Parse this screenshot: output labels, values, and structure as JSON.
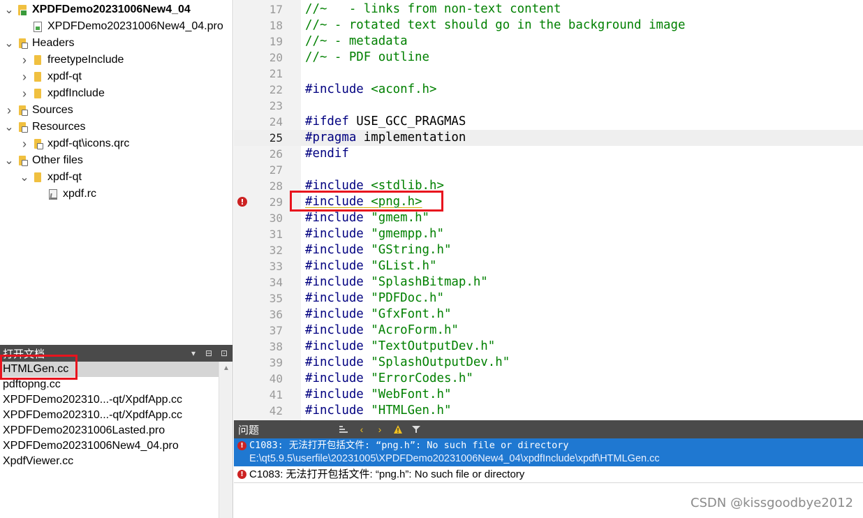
{
  "project_tree": {
    "rows": [
      {
        "label": "XPDFDemo20231006New4_04",
        "icon": "project-icon",
        "arrow": "v",
        "bold": true
      },
      {
        "label": "XPDFDemo20231006New4_04.pro",
        "icon": "pro-file-icon",
        "arrow": ""
      },
      {
        "label": "Headers",
        "icon": "headers-folder-icon",
        "arrow": "v"
      },
      {
        "label": "freetypeInclude",
        "icon": "folder-icon",
        "arrow": ">"
      },
      {
        "label": "xpdf-qt",
        "icon": "folder-icon",
        "arrow": ">"
      },
      {
        "label": "xpdfInclude",
        "icon": "folder-icon",
        "arrow": ">"
      },
      {
        "label": "Sources",
        "icon": "sources-folder-icon",
        "arrow": ">"
      },
      {
        "label": "Resources",
        "icon": "resources-folder-icon",
        "arrow": "v"
      },
      {
        "label": "xpdf-qt\\icons.qrc",
        "icon": "qrc-file-icon",
        "arrow": ">"
      },
      {
        "label": "Other files",
        "icon": "other-files-folder-icon",
        "arrow": "v"
      },
      {
        "label": "xpdf-qt",
        "icon": "folder-icon",
        "arrow": "v"
      },
      {
        "label": "xpdf.rc",
        "icon": "rc-file-icon",
        "arrow": ""
      }
    ]
  },
  "open_documents": {
    "title": "打开文档",
    "items": [
      "HTMLGen.cc",
      "pdftopng.cc",
      "XPDFDemo202310...-qt/XpdfApp.cc",
      "XPDFDemo202310...-qt/XpdfApp.cc",
      "XPDFDemo20231006Lasted.pro",
      "XPDFDemo20231006New4_04.pro",
      "XpdfViewer.cc"
    ],
    "selected_index": 0
  },
  "editor": {
    "current_line": 25,
    "error_line": 29,
    "lines": [
      {
        "n": "17",
        "tokens": [
          {
            "t": "//~   - links from non-text content",
            "c": "comment"
          }
        ]
      },
      {
        "n": "18",
        "tokens": [
          {
            "t": "//~ - rotated text should go in the background image",
            "c": "comment"
          }
        ]
      },
      {
        "n": "19",
        "tokens": [
          {
            "t": "//~ - metadata",
            "c": "comment"
          }
        ]
      },
      {
        "n": "20",
        "tokens": [
          {
            "t": "//~ - PDF outline",
            "c": "comment"
          }
        ]
      },
      {
        "n": "21",
        "tokens": []
      },
      {
        "n": "22",
        "tokens": [
          {
            "t": "#include",
            "c": "directive"
          },
          {
            "t": " ",
            "c": "plain"
          },
          {
            "t": "<aconf.h>",
            "c": "sys"
          }
        ]
      },
      {
        "n": "23",
        "tokens": []
      },
      {
        "n": "24",
        "tokens": [
          {
            "t": "#ifdef",
            "c": "directive"
          },
          {
            "t": " USE_GCC_PRAGMAS",
            "c": "plain"
          }
        ]
      },
      {
        "n": "25",
        "tokens": [
          {
            "t": "#pragma",
            "c": "directive"
          },
          {
            "t": " implementation",
            "c": "plain"
          }
        ]
      },
      {
        "n": "26",
        "tokens": [
          {
            "t": "#endif",
            "c": "directive"
          }
        ]
      },
      {
        "n": "27",
        "tokens": []
      },
      {
        "n": "28",
        "tokens": [
          {
            "t": "#include",
            "c": "directive"
          },
          {
            "t": " ",
            "c": "plain"
          },
          {
            "t": "<stdlib.h>",
            "c": "sys"
          }
        ]
      },
      {
        "n": "29",
        "tokens": [
          {
            "t": "#include",
            "c": "directive"
          },
          {
            "t": " ",
            "c": "plain"
          },
          {
            "t": "<png.h>",
            "c": "sys"
          }
        ]
      },
      {
        "n": "30",
        "tokens": [
          {
            "t": "#include",
            "c": "directive"
          },
          {
            "t": " ",
            "c": "plain"
          },
          {
            "t": "\"gmem.h\"",
            "c": "str"
          }
        ]
      },
      {
        "n": "31",
        "tokens": [
          {
            "t": "#include",
            "c": "directive"
          },
          {
            "t": " ",
            "c": "plain"
          },
          {
            "t": "\"gmempp.h\"",
            "c": "str"
          }
        ]
      },
      {
        "n": "32",
        "tokens": [
          {
            "t": "#include",
            "c": "directive"
          },
          {
            "t": " ",
            "c": "plain"
          },
          {
            "t": "\"GString.h\"",
            "c": "str"
          }
        ]
      },
      {
        "n": "33",
        "tokens": [
          {
            "t": "#include",
            "c": "directive"
          },
          {
            "t": " ",
            "c": "plain"
          },
          {
            "t": "\"GList.h\"",
            "c": "str"
          }
        ]
      },
      {
        "n": "34",
        "tokens": [
          {
            "t": "#include",
            "c": "directive"
          },
          {
            "t": " ",
            "c": "plain"
          },
          {
            "t": "\"SplashBitmap.h\"",
            "c": "str"
          }
        ]
      },
      {
        "n": "35",
        "tokens": [
          {
            "t": "#include",
            "c": "directive"
          },
          {
            "t": " ",
            "c": "plain"
          },
          {
            "t": "\"PDFDoc.h\"",
            "c": "str"
          }
        ]
      },
      {
        "n": "36",
        "tokens": [
          {
            "t": "#include",
            "c": "directive"
          },
          {
            "t": " ",
            "c": "plain"
          },
          {
            "t": "\"GfxFont.h\"",
            "c": "str"
          }
        ]
      },
      {
        "n": "37",
        "tokens": [
          {
            "t": "#include",
            "c": "directive"
          },
          {
            "t": " ",
            "c": "plain"
          },
          {
            "t": "\"AcroForm.h\"",
            "c": "str"
          }
        ]
      },
      {
        "n": "38",
        "tokens": [
          {
            "t": "#include",
            "c": "directive"
          },
          {
            "t": " ",
            "c": "plain"
          },
          {
            "t": "\"TextOutputDev.h\"",
            "c": "str"
          }
        ]
      },
      {
        "n": "39",
        "tokens": [
          {
            "t": "#include",
            "c": "directive"
          },
          {
            "t": " ",
            "c": "plain"
          },
          {
            "t": "\"SplashOutputDev.h\"",
            "c": "str"
          }
        ]
      },
      {
        "n": "40",
        "tokens": [
          {
            "t": "#include",
            "c": "directive"
          },
          {
            "t": " ",
            "c": "plain"
          },
          {
            "t": "\"ErrorCodes.h\"",
            "c": "str"
          }
        ]
      },
      {
        "n": "41",
        "tokens": [
          {
            "t": "#include",
            "c": "directive"
          },
          {
            "t": " ",
            "c": "plain"
          },
          {
            "t": "\"WebFont.h\"",
            "c": "str"
          }
        ]
      },
      {
        "n": "42",
        "tokens": [
          {
            "t": "#include",
            "c": "directive"
          },
          {
            "t": " ",
            "c": "plain"
          },
          {
            "t": "\"HTMLGen.h\"",
            "c": "str"
          }
        ]
      }
    ]
  },
  "issues": {
    "title": "问题",
    "selected": {
      "message": "C1083: 无法打开包括文件: “png.h”: No such file or directory",
      "path": "E:\\qt5.9.5\\userfile\\20231005\\XPDFDemo20231006New4_04\\xpdfInclude\\xpdf\\HTMLGen.cc"
    },
    "items": [
      {
        "message": "C1083: 无法打开包括文件: “png.h”: No such file or directory"
      }
    ],
    "colors": {
      "selected_bg": "#1f78d1",
      "error": "#cc2222",
      "highlight_box": "#e8141e"
    }
  },
  "watermark": "CSDN @kissgoodbye2012"
}
